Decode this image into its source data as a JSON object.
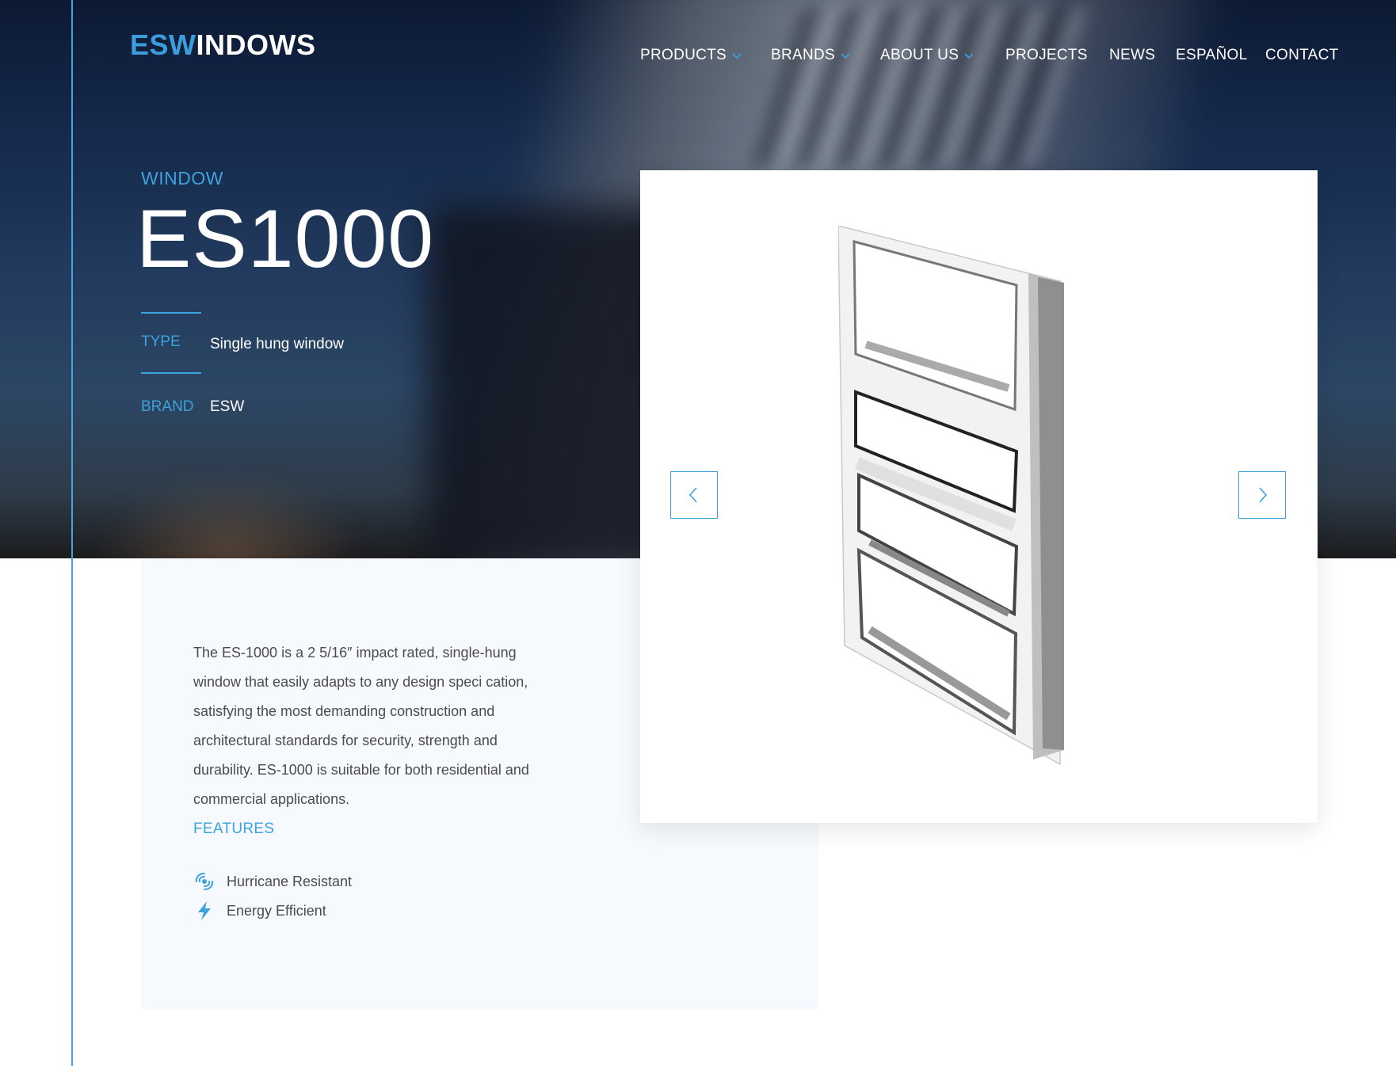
{
  "logo": {
    "part1": "ESW",
    "part2": "INDOWS"
  },
  "nav": {
    "items": [
      {
        "label": "PRODUCTS",
        "dropdown": true
      },
      {
        "label": "BRANDS",
        "dropdown": true
      },
      {
        "label": "ABOUT US",
        "dropdown": true
      },
      {
        "label": "PROJECTS",
        "dropdown": false
      },
      {
        "label": "NEWS",
        "dropdown": false
      },
      {
        "label": "ESPAÑOL",
        "dropdown": false
      },
      {
        "label": "CONTACT",
        "dropdown": false
      }
    ]
  },
  "product": {
    "category": "WINDOW",
    "model": "ES1000",
    "specs": {
      "type_label": "TYPE",
      "type_value": "Single hung window",
      "brand_label": "BRAND",
      "brand_value": "ESW"
    },
    "description": "The ES-1000 is a 2 5/16″ impact rated, single-hung window that easily adapts to any design speci cation, satisfying the most demanding construction and architectural standards for security, strength and durability. ES-1000 is suitable for both residential and commercial applications.",
    "features_title": "FEATURES",
    "features": [
      {
        "icon": "hurricane-icon",
        "label": "Hurricane Resistant"
      },
      {
        "icon": "lightning-icon",
        "label": "Energy Efficient"
      }
    ]
  },
  "gallery": {
    "image": "single-hung-window-image",
    "prev_icon": "chevron-left-icon",
    "next_icon": "chevron-right-icon"
  },
  "colors": {
    "accent": "#3ea2dd",
    "hero_dark": "#0c1a33",
    "panel_bg": "#f6f9fd",
    "body_text": "#4c4c4c"
  }
}
